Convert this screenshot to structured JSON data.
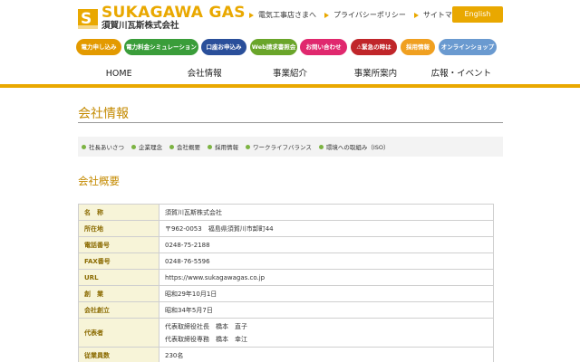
{
  "header": {
    "logo_mark": "S",
    "logo_en": "SUKAGAWA GAS",
    "logo_jp": "須賀川瓦斯株式会社",
    "top_links": [
      "電気工事店さまへ",
      "プライバシーポリシー",
      "サイトマップ"
    ],
    "english_label": "English",
    "accent_color": "#e9a800"
  },
  "pills": [
    {
      "label": "電力申し込み",
      "color": "#e39a00"
    },
    {
      "label": "電力料金シミュレーション",
      "color": "#3a9d3a"
    },
    {
      "label": "口座お申込み",
      "color": "#2a4f9a"
    },
    {
      "label": "Web請求書照会",
      "color": "#6aa52a"
    },
    {
      "label": "お問い合わせ",
      "color": "#e0286e"
    },
    {
      "label": "⚠緊急の時は",
      "color": "#c0262a"
    },
    {
      "label": "採用情報",
      "color": "#f0a020"
    },
    {
      "label": "オンラインショップ",
      "color": "#6a9ad0"
    }
  ],
  "nav": [
    "HOME",
    "会社情報",
    "事業紹介",
    "事業所案内",
    "広報・イベント"
  ],
  "main": {
    "page_title": "会社情報",
    "subnav": [
      "社長あいさつ",
      "企業理念",
      "会社概要",
      "採用情報",
      "ワークライフバランス",
      "環境への取組み（ISO）"
    ],
    "section_title": "会社概要",
    "rows": [
      {
        "label": "名　称",
        "value": "須賀川瓦斯株式会社"
      },
      {
        "label": "所在地",
        "value": "〒962-0053　福島県須賀川市卸町44"
      },
      {
        "label": "電話番号",
        "value": "0248-75-2188"
      },
      {
        "label": "FAX番号",
        "value": "0248-76-5596"
      },
      {
        "label": "URL",
        "value": "https://www.sukagawagas.co.jp"
      },
      {
        "label": "創　業",
        "value": "昭和29年10月1日"
      },
      {
        "label": "会社創立",
        "value": "昭和34年5月7日"
      },
      {
        "label": "代表者",
        "value": "代表取締役社長　橋本　直子",
        "value2": "代表取締役専務　橋本　幸江"
      },
      {
        "label": "従業員数",
        "value": "230名"
      }
    ]
  }
}
